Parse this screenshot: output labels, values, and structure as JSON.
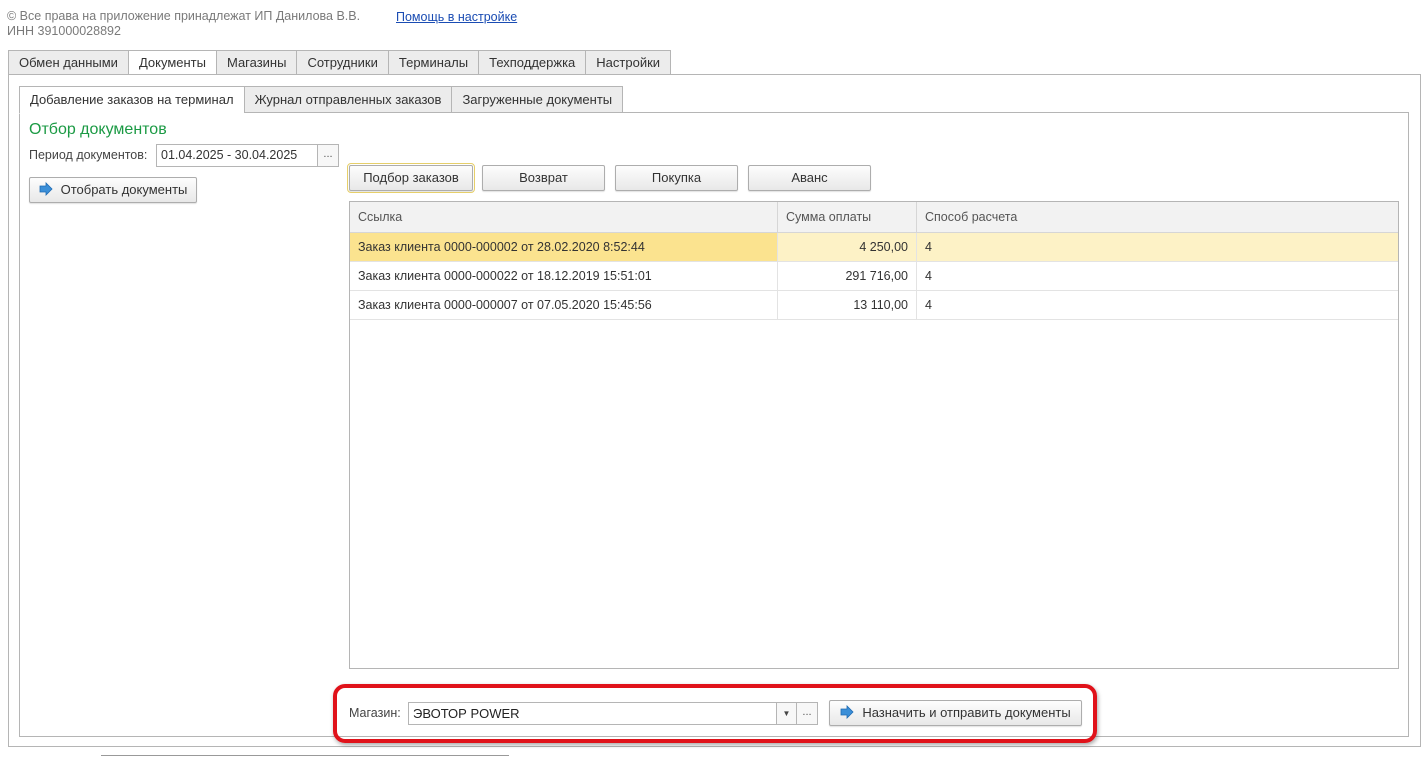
{
  "header": {
    "copyright": "© Все права на приложение принадлежат ИП Данилова В.В.",
    "inn": "ИНН 391000028892",
    "help_link": "Помощь в настройке"
  },
  "top_tabs": [
    {
      "label": "Обмен данными"
    },
    {
      "label": "Документы"
    },
    {
      "label": "Магазины"
    },
    {
      "label": "Сотрудники"
    },
    {
      "label": "Терминалы"
    },
    {
      "label": "Техподдержка"
    },
    {
      "label": "Настройки"
    }
  ],
  "inner_tabs": [
    {
      "label": "Добавление заказов на терминал"
    },
    {
      "label": "Журнал отправленных заказов"
    },
    {
      "label": "Загруженные документы"
    }
  ],
  "filter": {
    "title": "Отбор документов",
    "period_label": "Период документов:",
    "period_value": "01.04.2025 - 30.04.2025",
    "dots": "...",
    "select_button": "Отобрать документы"
  },
  "actions": {
    "podbor": "Подбор заказов",
    "vozvrat": "Возврат",
    "pokupka": "Покупка",
    "avans": "Аванс"
  },
  "table": {
    "headers": [
      "Ссылка",
      "Сумма оплаты",
      "Способ расчета"
    ],
    "rows": [
      {
        "link": "Заказ клиента 0000-000002 от 28.02.2020 8:52:44",
        "sum": "4 250,00",
        "method": "4"
      },
      {
        "link": "Заказ клиента 0000-000022 от 18.12.2019 15:51:01",
        "sum": "291 716,00",
        "method": "4"
      },
      {
        "link": "Заказ клиента 0000-000007 от 07.05.2020 15:45:56",
        "sum": "13 110,00",
        "method": "4"
      }
    ]
  },
  "store": {
    "label": "Магазин:",
    "value": "ЭВОТОР POWER",
    "dots": "...",
    "send_button": "Назначить и отправить  документы"
  },
  "colors": {
    "accent_green": "#1b9a44",
    "selected_row": "#fbe38f",
    "highlight_red": "#e0121a",
    "link_blue": "#1a4cb3"
  }
}
